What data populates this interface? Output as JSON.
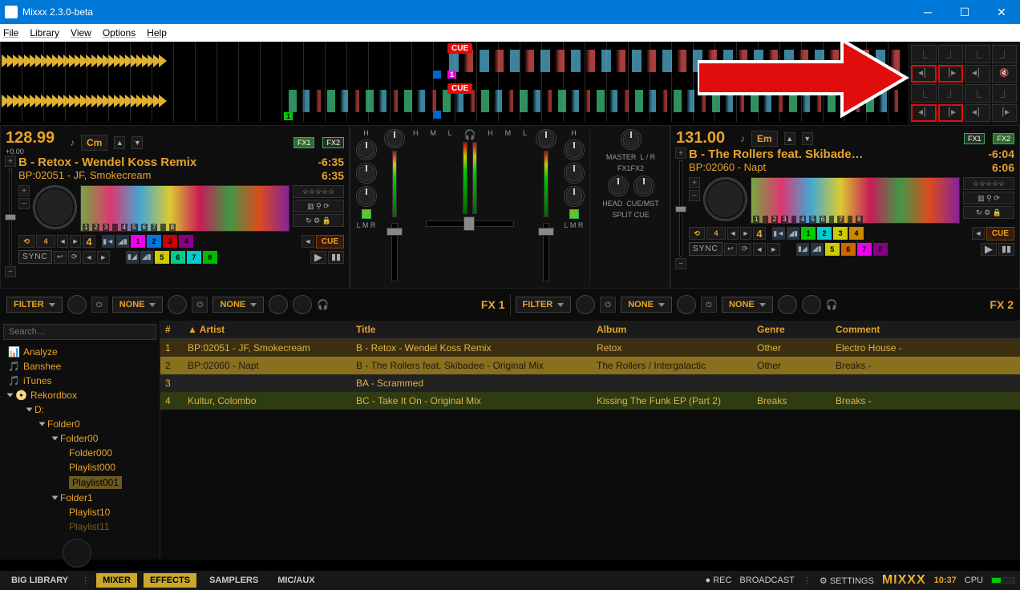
{
  "titlebar": {
    "title": "Mixxx 2.3.0-beta"
  },
  "menu": {
    "file": "File",
    "library": "Library",
    "view": "View",
    "options": "Options",
    "help": "Help"
  },
  "overview": {
    "cue_label": "CUE",
    "trackA_hot1": "1",
    "trackB_hot1": "1"
  },
  "deckA": {
    "bpm": "128.99",
    "bpm_delta": "+0.00",
    "key": "Cm",
    "fx1": "FX1",
    "fx2": "FX2",
    "title": "B - Retox - Wendel Koss Remix",
    "artist": "BP:02051 - JF, Smokecream",
    "remain": "-6:35",
    "total": "6:35",
    "loop_size": "4",
    "sync": "SYNC",
    "cue": "CUE",
    "hotcues": [
      "1",
      "2",
      "3",
      "4",
      "5",
      "6",
      "7",
      "8"
    ],
    "wave_marks": [
      "1",
      "2",
      "3",
      "4",
      "5",
      "6",
      "7",
      "8"
    ]
  },
  "deckB": {
    "bpm": "131.00",
    "bpm_delta": "",
    "key": "Em",
    "fx1": "FX1",
    "fx2": "FX2",
    "title": "B - The Rollers feat. Skibade…",
    "artist": "BP:02060 - Napt",
    "remain": "-6:04",
    "total": "6:06",
    "loop_size": "4",
    "sync": "SYNC",
    "cue": "CUE",
    "hotcues": [
      "1",
      "2",
      "3",
      "4",
      "5",
      "6",
      "7",
      "8"
    ],
    "wave_marks": [
      "1",
      "2",
      "3",
      "4",
      "5",
      "6",
      "7",
      "8"
    ]
  },
  "mixer": {
    "eq_labels": [
      "H",
      "M",
      "L"
    ],
    "lmr": "L M R",
    "master": "MASTER",
    "lr": "L / R",
    "fx1": "FX1",
    "fx2": "FX2",
    "head": "HEAD",
    "cuemst": "CUE/MST",
    "split": "SPLIT CUE"
  },
  "fx": {
    "filter": "FILTER",
    "none": "NONE",
    "fx1": "FX 1",
    "fx2": "FX 2"
  },
  "library": {
    "search_placeholder": "Search…",
    "tree": {
      "analyze": "Analyze",
      "banshee": "Banshee",
      "itunes": "iTunes",
      "rekordbox": "Rekordbox",
      "d": "D:",
      "f0": "Folder0",
      "f00": "Folder00",
      "f000": "Folder000",
      "pl000": "Playlist000",
      "pl001": "Playlist001",
      "f1": "Folder1",
      "pl10": "Playlist10",
      "pl11": "Playlist11"
    },
    "columns": {
      "num": "#",
      "artist": "Artist",
      "title": "Title",
      "album": "Album",
      "genre": "Genre",
      "comment": "Comment"
    },
    "rows": [
      {
        "n": "1",
        "artist": "BP:02051 - JF, Smokecream",
        "title": "B - Retox - Wendel Koss Remix",
        "album": "Retox",
        "genre": "Other",
        "comment": "Electro House -"
      },
      {
        "n": "2",
        "artist": "BP:02060 - Napt",
        "title": "B - The Rollers feat. Skibadee - Original Mix",
        "album": "The Rollers / Intergalactic",
        "genre": "Other",
        "comment": "Breaks -"
      },
      {
        "n": "3",
        "artist": "",
        "title": "BA - Scrammed",
        "album": "",
        "genre": "",
        "comment": ""
      },
      {
        "n": "4",
        "artist": "Kultur, Colombo",
        "title": "BC - Take It On - Original Mix",
        "album": "Kissing The Funk EP (Part 2)",
        "genre": "Breaks",
        "comment": "Breaks -"
      }
    ]
  },
  "status": {
    "big": "BIG LIBRARY",
    "mixer": "MIXER",
    "effects": "EFFECTS",
    "samplers": "SAMPLERS",
    "micaux": "MIC/AUX",
    "rec": "REC",
    "broadcast": "BROADCAST",
    "settings": "SETTINGS",
    "logo": "MIXXX",
    "clock": "10:37",
    "cpu": "CPU"
  }
}
